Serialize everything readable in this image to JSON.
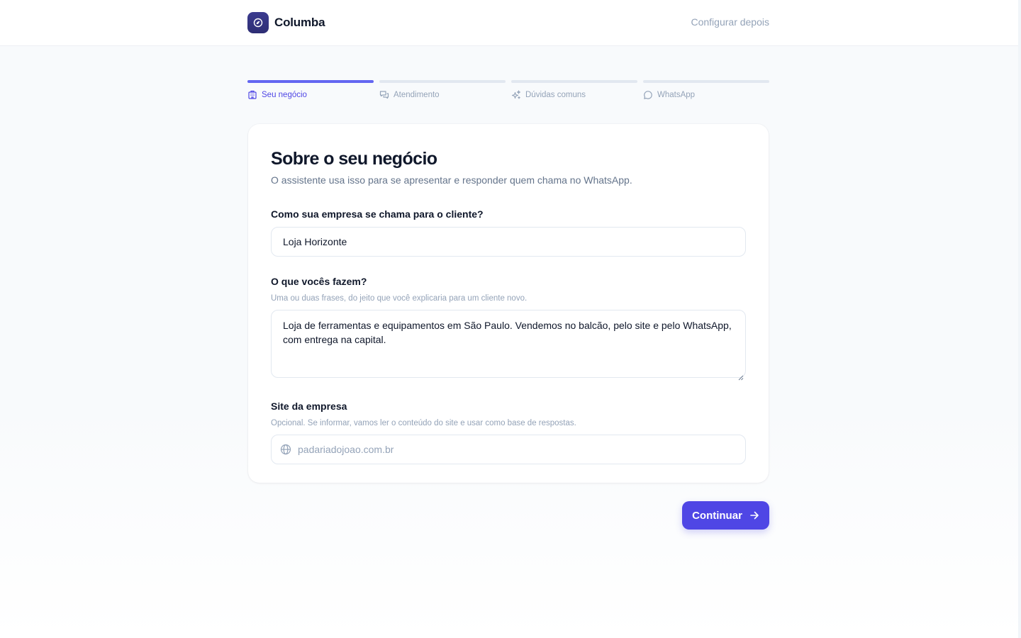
{
  "header": {
    "brand_name": "Columba",
    "skip_label": "Configurar depois"
  },
  "steps": [
    {
      "label": "Seu negócio",
      "icon": "building-icon",
      "active": true
    },
    {
      "label": "Atendimento",
      "icon": "chat-bubbles-icon",
      "active": false
    },
    {
      "label": "Dúvidas comuns",
      "icon": "sparkles-icon",
      "active": false
    },
    {
      "label": "WhatsApp",
      "icon": "message-circle-icon",
      "active": false
    }
  ],
  "card": {
    "title": "Sobre o seu negócio",
    "subtitle": "O assistente usa isso para se apresentar e responder quem chama no WhatsApp.",
    "company_name": {
      "label": "Como sua empresa se chama para o cliente?",
      "value": "Loja Horizonte"
    },
    "description": {
      "label": "O que vocês fazem?",
      "hint": "Uma ou duas frases, do jeito que você explicaria para um cliente novo.",
      "value": "Loja de ferramentas e equipamentos em São Paulo. Vendemos no balcão, pelo site e pelo WhatsApp, com entrega na capital."
    },
    "website": {
      "label": "Site da empresa",
      "hint": "Opcional. Se informar, vamos ler o conteúdo do site e usar como base de respostas.",
      "placeholder": "padariadojoao.com.br",
      "value": ""
    }
  },
  "footer": {
    "continue_label": "Continuar"
  },
  "colors": {
    "accent": "#4f46e5",
    "step_active": "#6366f1",
    "step_inactive": "#e2e8f0",
    "brand_logo": "#2e2e74"
  }
}
